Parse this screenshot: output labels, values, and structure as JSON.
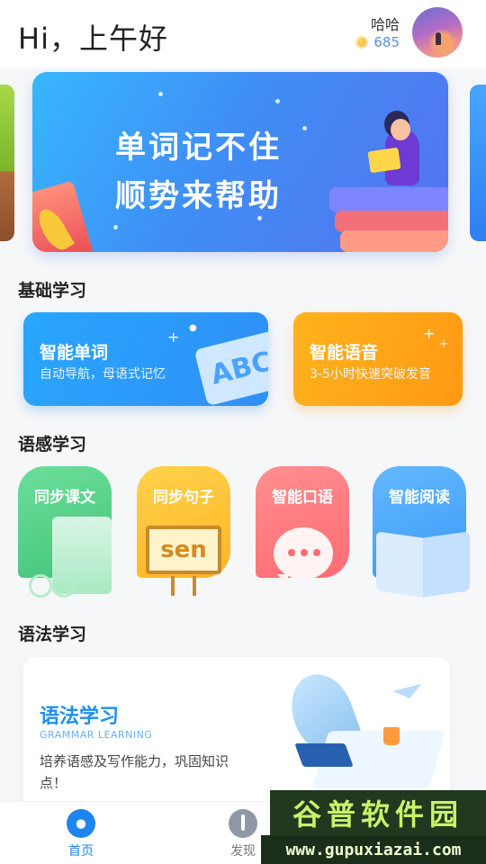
{
  "header": {
    "greeting": "Hi，上午好",
    "username": "哈哈",
    "coins": "685"
  },
  "banner": {
    "line1": "单词记不住",
    "line2": "顺势来帮助"
  },
  "sections": {
    "basic": "基础学习",
    "sense": "语感学习",
    "grammar": "语法学习"
  },
  "basic_cards": [
    {
      "title": "智能单词",
      "subtitle": "自动导航，母语式记忆",
      "art_text": "ABC",
      "color": "#2a9cf9"
    },
    {
      "title": "智能语音",
      "subtitle": "3-5小时快速突破发音",
      "color": "#ffa51a"
    }
  ],
  "sense_tiles": [
    {
      "label": "同步课文",
      "color": "#52cf86"
    },
    {
      "label": "同步句子",
      "art_text": "sen",
      "color": "#ffc336"
    },
    {
      "label": "智能口语",
      "color": "#ff7b80"
    },
    {
      "label": "智能阅读",
      "color": "#4aa8fb"
    }
  ],
  "grammar_card": {
    "title": "语法学习",
    "subtitle": "GRAMMAR LEARNING",
    "description": "培养语感及写作能力，巩固知识点！"
  },
  "bottom_nav": {
    "home": "首页",
    "discover": "发现"
  },
  "watermark": {
    "name": "谷普软件园",
    "url": "www.gupuxiazai.com"
  },
  "colors": {
    "accent": "#1e84f0",
    "coin_text": "#5c8fd6"
  }
}
